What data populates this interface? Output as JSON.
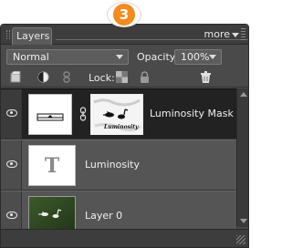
{
  "step_badge": "3",
  "panel": {
    "tab_label": "Layers",
    "more_label": "more",
    "blend_mode": "Normal",
    "opacity_label": "Opacity:",
    "opacity_value": "100%",
    "lock_label": "Lock:"
  },
  "layers": [
    {
      "name": "Luminosity Mask",
      "selected": true,
      "visible": true,
      "thumb": "adjustment-white"
    },
    {
      "name": "Luminosity",
      "selected": false,
      "visible": true,
      "thumb": "text-T",
      "thumb_text": "T"
    },
    {
      "name": "Layer 0",
      "selected": false,
      "visible": true,
      "thumb": "photo-birds"
    }
  ],
  "colors": {
    "panel_bg": "#4a4a4a",
    "row_bg": "#555555",
    "selected_row_bg": "#222222",
    "badge": "#f58a1f"
  },
  "icons": {
    "new_layer": "new-layer-icon",
    "adjustment": "half-circle-adjustment-icon",
    "link": "link-icon",
    "lock_transparent": "lock-transparent-icon",
    "lock_all": "lock-all-icon",
    "trash": "trash-icon",
    "eye": "eye-icon",
    "mask_link": "chain-link-icon"
  }
}
